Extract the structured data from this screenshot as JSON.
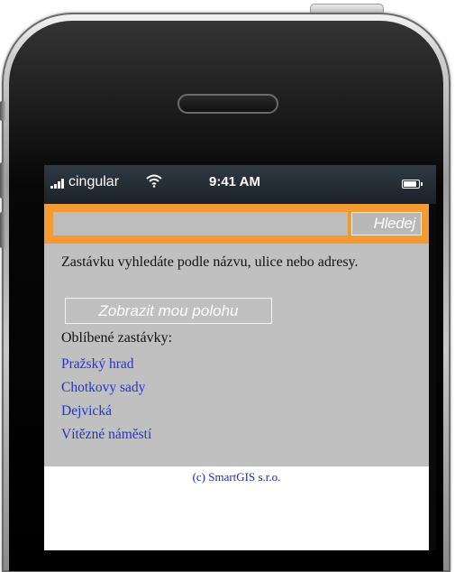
{
  "statusbar": {
    "carrier": "cingular",
    "wifi_icon": "wifi-icon",
    "time": "9:41 AM",
    "battery_level": 0.9
  },
  "search": {
    "input_value": "",
    "input_placeholder": "",
    "button_label": "Hledej"
  },
  "main": {
    "hint": "Zastávku vyhledáte podle názvu, ulice nebo adresy.",
    "location_button": "Zobrazit mou polohu",
    "favorites_title": "Oblíbené zastávky:",
    "favorites": [
      "Pražský hrad",
      "Chotkovy sady",
      "Dejvická",
      "Vítězné náměstí"
    ]
  },
  "footer": {
    "text": "(c) SmartGIS s.r.o."
  },
  "colors": {
    "accent": "#f39a33",
    "panel": "#c0c0c0",
    "link": "#2234c6"
  }
}
